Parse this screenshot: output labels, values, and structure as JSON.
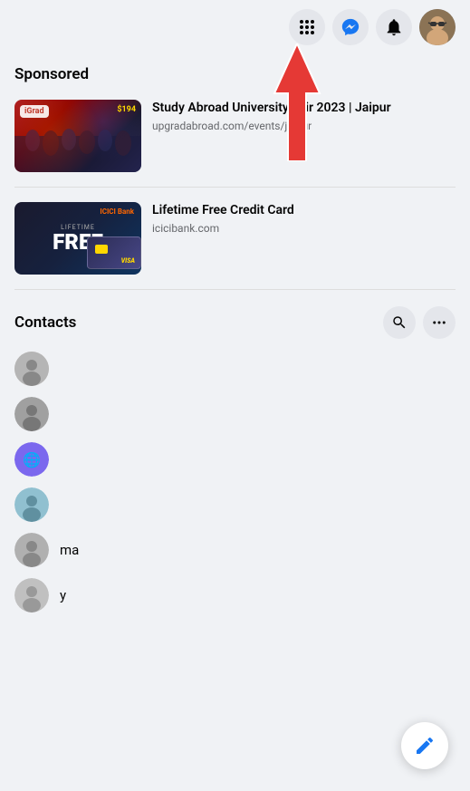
{
  "header": {
    "icons": [
      {
        "name": "grid-icon",
        "symbol": "⊞",
        "label": "Menu"
      },
      {
        "name": "messenger-icon",
        "symbol": "💬",
        "label": "Messenger"
      },
      {
        "name": "notification-icon",
        "symbol": "🔔",
        "label": "Notifications"
      }
    ],
    "avatar_label": "User Profile"
  },
  "sponsored": {
    "section_label": "Sponsored",
    "ads": [
      {
        "id": "ad-1",
        "logo": "iGrad $194",
        "price": "$194",
        "title": "Study Abroad University Fair 2023 | Jaipur",
        "url": "upgradabroad.com/events/jaipur",
        "thumb_type": "study-abroad"
      },
      {
        "id": "ad-2",
        "title": "Lifetime Free Credit Card",
        "url": "icicibank.com",
        "thumb_type": "icici",
        "free_text": "FREE",
        "lifetime_text": "LIFETIME",
        "card_brand": "VISA"
      }
    ]
  },
  "contacts": {
    "section_label": "Contacts",
    "search_tooltip": "Search contacts",
    "more_tooltip": "More options",
    "items": [
      {
        "id": "c1",
        "name": "",
        "initial": "👤",
        "color": "#b5b5b5"
      },
      {
        "id": "c2",
        "name": "",
        "initial": "👤",
        "color": "#a0a0a0"
      },
      {
        "id": "c3",
        "name": "",
        "initial": "🌐",
        "color": "#7b68ee"
      },
      {
        "id": "c4",
        "name": "",
        "initial": "👤",
        "color": "#90c0d0"
      },
      {
        "id": "c5",
        "name": "ma",
        "initial": "👤",
        "color": "#b0b0b0"
      },
      {
        "id": "c6",
        "name": "y",
        "initial": "👤",
        "color": "#c0c0c0"
      }
    ]
  },
  "fab": {
    "label": "New message",
    "icon": "✏️"
  },
  "arrow": {
    "visible": true,
    "description": "Red upward arrow pointing to messenger icon"
  }
}
